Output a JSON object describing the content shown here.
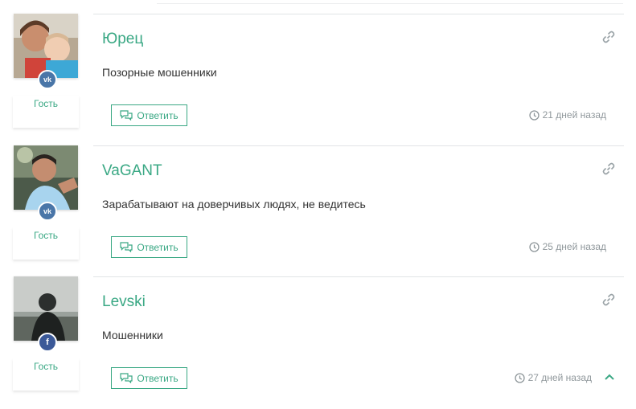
{
  "colors": {
    "accent": "#3aa884",
    "muted": "#8f979b",
    "vk": "#4a76a8",
    "facebook": "#3b5998"
  },
  "comments": [
    {
      "author": "Юрец",
      "text": "Позорные мошенники",
      "role": "Гость",
      "time": "21 дней назад",
      "reply_label": "Ответить",
      "social": "vk",
      "social_glyph": "vk"
    },
    {
      "author": "VaGANT",
      "text": "Зарабатывают на доверчивых людях, не ведитесь",
      "role": "Гость",
      "time": "25 дней назад",
      "reply_label": "Ответить",
      "social": "vk",
      "social_glyph": "vk"
    },
    {
      "author": "Levski",
      "text": "Мошенники",
      "role": "Гость",
      "time": "27 дней назад",
      "reply_label": "Ответить",
      "social": "facebook",
      "social_glyph": "f"
    }
  ],
  "icons": {
    "link": "link-icon",
    "clock": "clock-icon",
    "reply": "chat-bubbles-icon",
    "scroll_up": "chevron-up-icon"
  }
}
